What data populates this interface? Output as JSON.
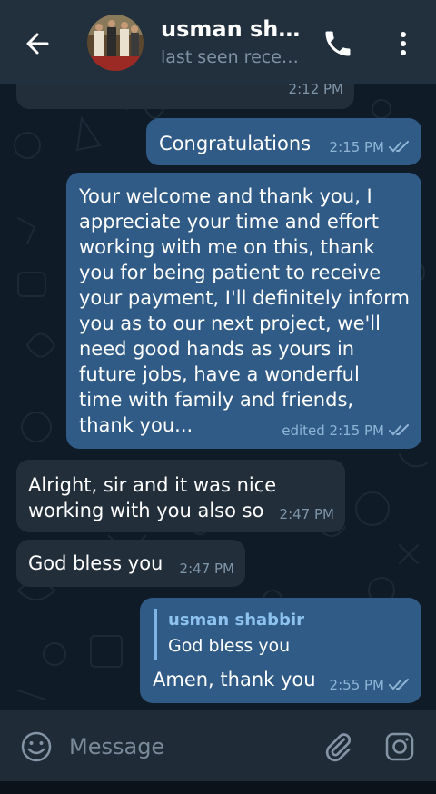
{
  "header": {
    "contact_name": "usman sh…",
    "status": "last seen rece…"
  },
  "messages": [
    {
      "direction": "in",
      "text": "",
      "time": "2:12 PM"
    },
    {
      "direction": "out",
      "text": "Congratulations",
      "time": "2:15 PM",
      "read": true
    },
    {
      "direction": "out",
      "lines": [
        "Your welcome and thank you, I",
        "appreciate your time and effort",
        "working with me on this, thank",
        "you for being patient to receive",
        "your payment, I'll definitely inform",
        "you as to our next project, we'll",
        "need good hands as yours in",
        "future jobs, have a wonderful",
        "time with family and friends,",
        "thank you..."
      ],
      "time": "edited 2:15 PM",
      "read": true
    },
    {
      "direction": "in",
      "lines": [
        "Alright, sir and it was nice",
        "working with you also so"
      ],
      "time": "2:47 PM"
    },
    {
      "direction": "in",
      "text": "God bless you",
      "time": "2:47 PM"
    },
    {
      "direction": "out",
      "reply_to": {
        "name": "usman shabbir",
        "text": "God bless you"
      },
      "text": "Amen, thank you",
      "time": "2:55 PM",
      "read": true
    }
  ],
  "composer": {
    "placeholder": "Message"
  },
  "colors": {
    "header_bg": "#222f3c",
    "chat_bg": "#0f1b26",
    "incoming_bubble": "#222f3b",
    "outgoing_bubble": "#2f5b86",
    "accent": "#8ec3f0"
  },
  "icons": [
    "back-arrow-icon",
    "phone-icon",
    "more-vertical-icon",
    "emoji-icon",
    "paperclip-icon",
    "camera-icon",
    "double-check-icon"
  ]
}
